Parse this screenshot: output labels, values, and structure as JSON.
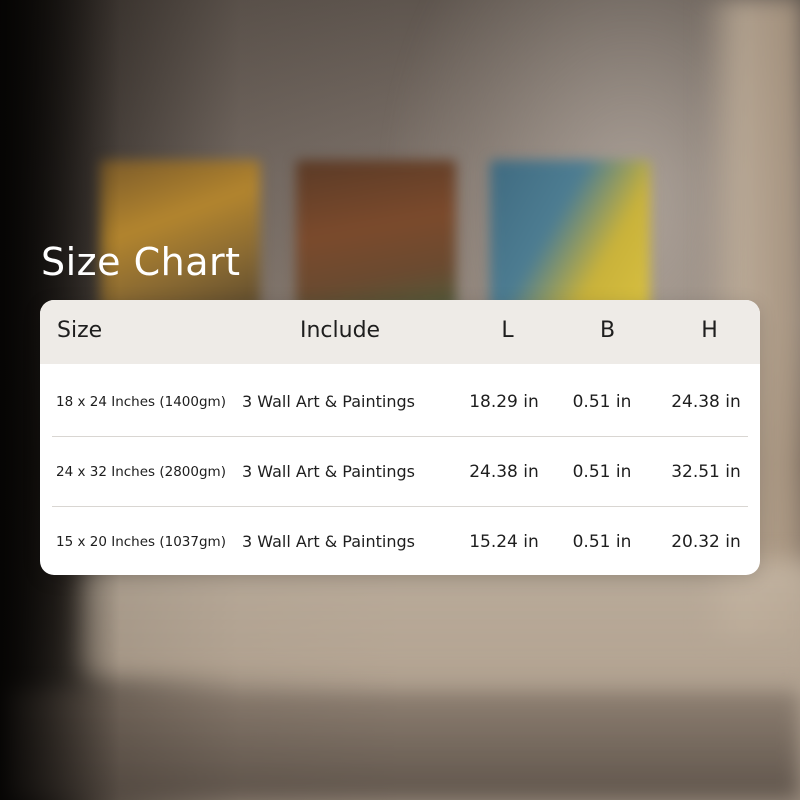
{
  "title": "Size Chart",
  "table": {
    "headers": {
      "size": "Size",
      "include": "Include",
      "l": "L",
      "b": "B",
      "h": "H"
    },
    "rows": [
      {
        "size": "18 x 24 Inches (1400gm)",
        "include": "3 Wall Art & Paintings",
        "l": "18.29 in",
        "b": "0.51 in",
        "h": "24.38 in"
      },
      {
        "size": "24 x 32 Inches (2800gm)",
        "include": "3 Wall Art & Paintings",
        "l": "24.38 in",
        "b": "0.51 in",
        "h": "32.51 in"
      },
      {
        "size": "15 x 20 Inches (1037gm)",
        "include": "3 Wall Art & Paintings",
        "l": "15.24 in",
        "b": "0.51 in",
        "h": "20.32 in"
      }
    ]
  }
}
